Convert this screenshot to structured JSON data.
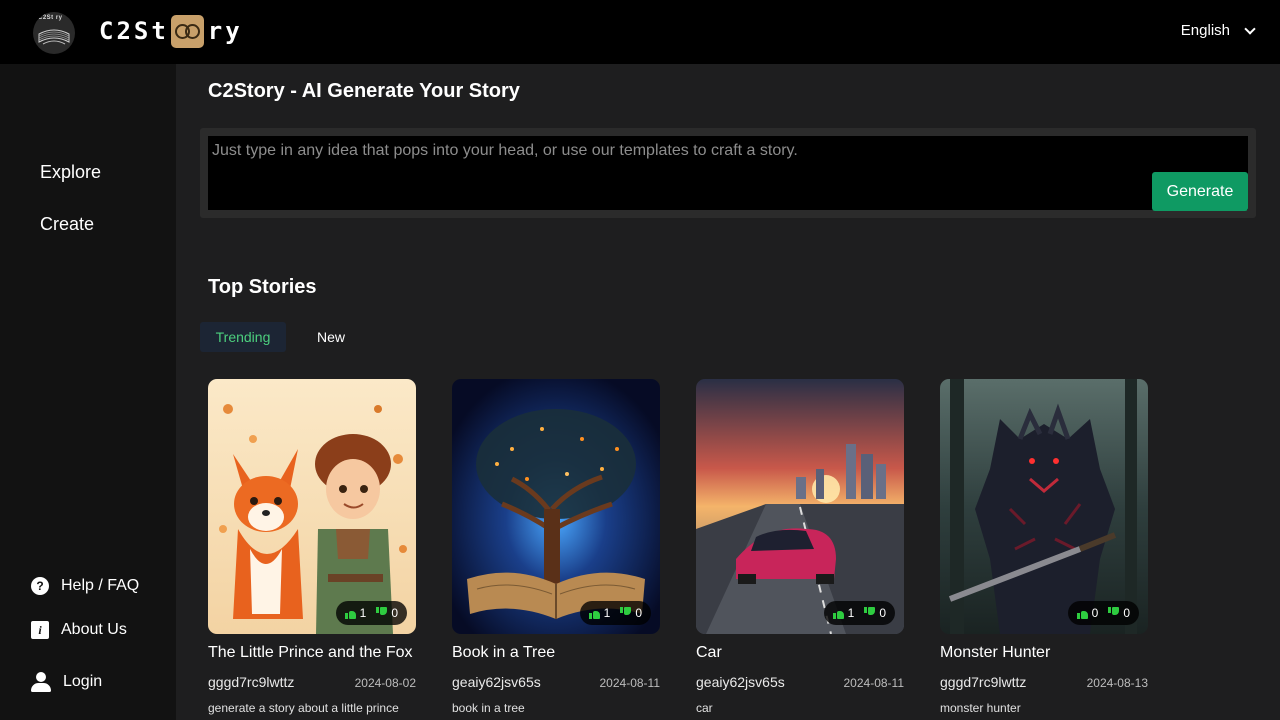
{
  "header": {
    "brand_small": "C2St ry",
    "brand_left": "C2St",
    "brand_right": "ry",
    "language": "English"
  },
  "sidebar": {
    "nav": [
      {
        "label": "Explore"
      },
      {
        "label": "Create"
      }
    ],
    "bottom": [
      {
        "label": "Help / FAQ",
        "icon": "question-icon"
      },
      {
        "label": "About Us",
        "icon": "info-icon"
      },
      {
        "label": "Login",
        "icon": "user-icon"
      }
    ]
  },
  "main": {
    "title": "C2Story - AI Generate Your Story",
    "prompt_placeholder": "Just type in any idea that pops into your head, or use our templates to craft a story.",
    "generate_label": "Generate",
    "section_title": "Top Stories",
    "tabs": [
      {
        "label": "Trending",
        "active": true
      },
      {
        "label": "New",
        "active": false
      }
    ],
    "stories": [
      {
        "title": "The Little Prince and the Fox",
        "author": "gggd7rc9lwttz",
        "date": "2024-08-02",
        "prompt": "generate a story about a little prince",
        "likes": "1",
        "dislikes": "0"
      },
      {
        "title": "Book in a Tree",
        "author": "geaiy62jsv65s",
        "date": "2024-08-11",
        "prompt": "book in a tree",
        "likes": "1",
        "dislikes": "0"
      },
      {
        "title": "Car",
        "author": "geaiy62jsv65s",
        "date": "2024-08-11",
        "prompt": "car",
        "likes": "1",
        "dislikes": "0"
      },
      {
        "title": "Monster Hunter",
        "author": "gggd7rc9lwttz",
        "date": "2024-08-13",
        "prompt": "monster hunter",
        "likes": "0",
        "dislikes": "0"
      }
    ]
  },
  "colors": {
    "accent": "#0f9a63",
    "tab_active_text": "#4ccf7e",
    "vote_green": "#2ecc40"
  }
}
